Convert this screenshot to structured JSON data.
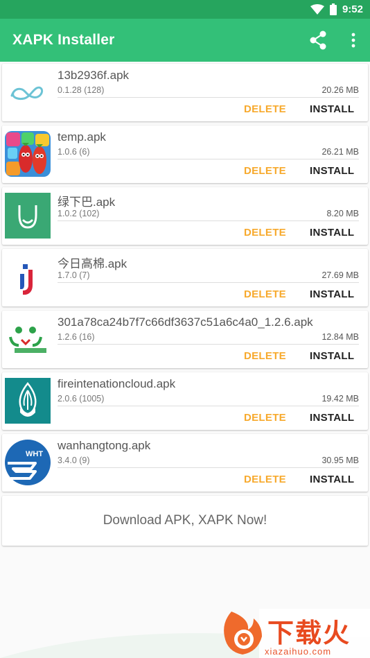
{
  "status_bar": {
    "time": "9:52"
  },
  "app_bar": {
    "title": "XAPK Installer"
  },
  "apps": [
    {
      "name": "13b2936f.apk",
      "version": "0.1.28 (128)",
      "size": "20.26 MB",
      "icon": "infinity-logo-icon"
    },
    {
      "name": "temp.apk",
      "version": "1.0.6 (6)",
      "size": "26.21 MB",
      "icon": "game-fruit-icon"
    },
    {
      "name": "绿下巴.apk",
      "version": "1.0.2 (102)",
      "size": "8.20 MB",
      "icon": "green-chin-icon"
    },
    {
      "name": "今日高棉.apk",
      "version": "1.7.0 (7)",
      "size": "27.69 MB",
      "icon": "j-logo-icon"
    },
    {
      "name": "301a78ca24b7f7c66df3637c51a6c4a0_1.2.6.apk",
      "version": "1.2.6 (16)",
      "size": "12.84 MB",
      "icon": "health-app-icon"
    },
    {
      "name": "fireintenationcloud.apk",
      "version": "2.0.6 (1005)",
      "size": "19.42 MB",
      "icon": "fire-shield-icon"
    },
    {
      "name": "wanhangtong.apk",
      "version": "3.4.0 (9)",
      "size": "30.95 MB",
      "icon": "wht-logo-icon"
    }
  ],
  "actions": {
    "delete_label": "DELETE",
    "install_label": "INSTALL"
  },
  "download_banner": "Download APK, XAPK Now!",
  "watermark": {
    "cn": "下载火",
    "url": "xiazaihuo.com"
  },
  "colors": {
    "primary": "#33c078",
    "status_bar": "#26a55e",
    "delete": "#f7a92c"
  }
}
